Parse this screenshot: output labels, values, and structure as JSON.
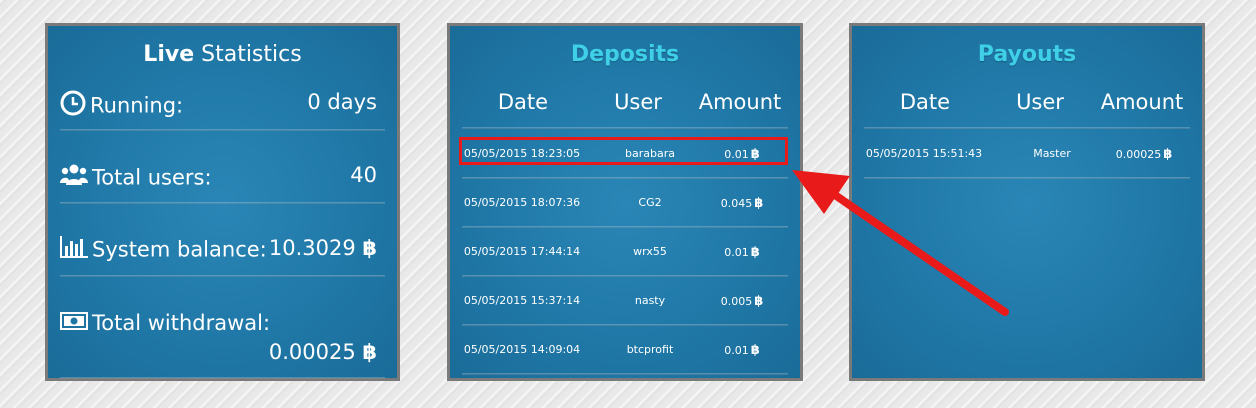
{
  "live_stats": {
    "title_bold": "Live",
    "title_rest": " Statistics",
    "running_label": "Running:",
    "running_value": "0 days",
    "users_label": "Total users:",
    "users_value": "40",
    "balance_label": "System balance:",
    "balance_value": "10.3029",
    "withdrawal_label": "Total withdrawal:",
    "withdrawal_value": "0.00025"
  },
  "btc_symbol": "฿",
  "deposits": {
    "title": "Deposits",
    "headers": [
      "Date",
      "User",
      "Amount"
    ],
    "rows": [
      {
        "date": "05/05/2015 18:23:05",
        "user": "barabara",
        "amount": "0.01"
      },
      {
        "date": "05/05/2015 18:07:36",
        "user": "CG2",
        "amount": "0.045"
      },
      {
        "date": "05/05/2015 17:44:14",
        "user": "wrx55",
        "amount": "0.01"
      },
      {
        "date": "05/05/2015 15:37:14",
        "user": "nasty",
        "amount": "0.005"
      },
      {
        "date": "05/05/2015 14:09:04",
        "user": "btcprofit",
        "amount": "0.01"
      }
    ]
  },
  "payouts": {
    "title": "Payouts",
    "headers": [
      "Date",
      "User",
      "Amount"
    ],
    "rows": [
      {
        "date": "05/05/2015 15:51:43",
        "user": "Master",
        "amount": "0.00025"
      }
    ]
  },
  "colors": {
    "panel": "#1f77a6",
    "title_accent": "#3fd0e8",
    "highlight": "#e81a1a"
  }
}
